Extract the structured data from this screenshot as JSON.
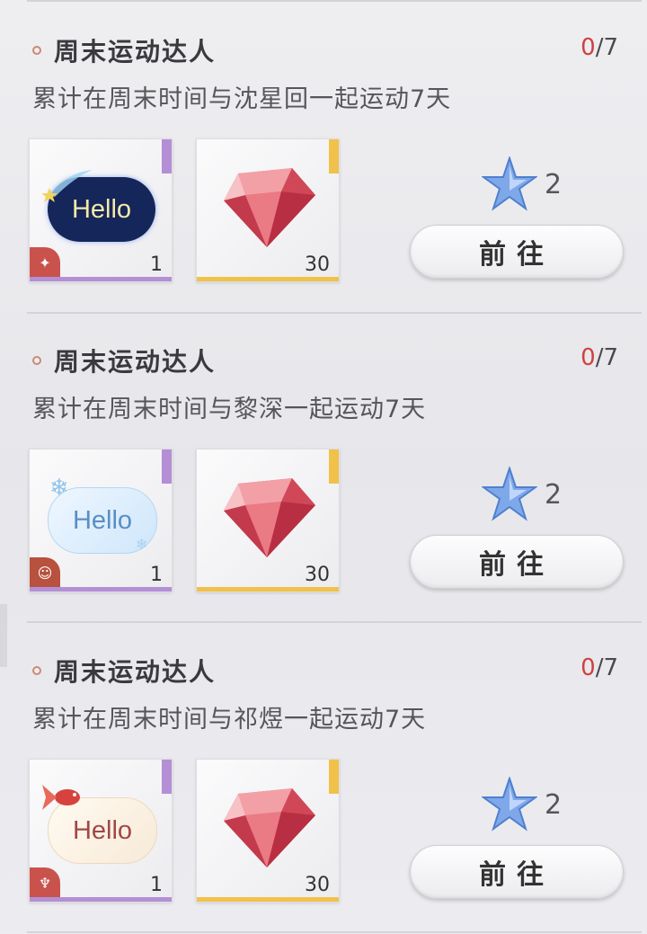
{
  "colors": {
    "accent_red": "#d0413f",
    "purple_bar": "#b48fd6",
    "gold_bar": "#f1c24a"
  },
  "tasks": [
    {
      "title": "周末运动达人",
      "progress_current": "0",
      "progress_sep": "/",
      "progress_total": "7",
      "description": "累计在周末时间与沈星回一起运动7天",
      "items": [
        {
          "kind": "hello-bubble",
          "bubble_text": "Hello",
          "count": "1",
          "icon": "shooting-star-icon",
          "badge_icon": "compass-star-icon"
        },
        {
          "kind": "gem",
          "count": "30",
          "icon": "red-diamond-icon"
        }
      ],
      "reward_icon": "blue-star-icon",
      "reward_count": "2",
      "button_label": "前往"
    },
    {
      "title": "周末运动达人",
      "progress_current": "0",
      "progress_sep": "/",
      "progress_total": "7",
      "description": "累计在周末时间与黎深一起运动7天",
      "items": [
        {
          "kind": "hello-bubble",
          "bubble_text": "Hello",
          "count": "1",
          "icon": "snowflake-icon",
          "badge_icon": "character-face-icon"
        },
        {
          "kind": "gem",
          "count": "30",
          "icon": "red-diamond-icon"
        }
      ],
      "reward_icon": "blue-star-icon",
      "reward_count": "2",
      "button_label": "前往"
    },
    {
      "title": "周末运动达人",
      "progress_current": "0",
      "progress_sep": "/",
      "progress_total": "7",
      "description": "累计在周末时间与祁煜一起运动7天",
      "items": [
        {
          "kind": "hello-bubble",
          "bubble_text": "Hello",
          "count": "1",
          "icon": "goldfish-icon",
          "badge_icon": "tail-fin-icon"
        },
        {
          "kind": "gem",
          "count": "30",
          "icon": "red-diamond-icon"
        }
      ],
      "reward_icon": "blue-star-icon",
      "reward_count": "2",
      "button_label": "前往"
    }
  ]
}
